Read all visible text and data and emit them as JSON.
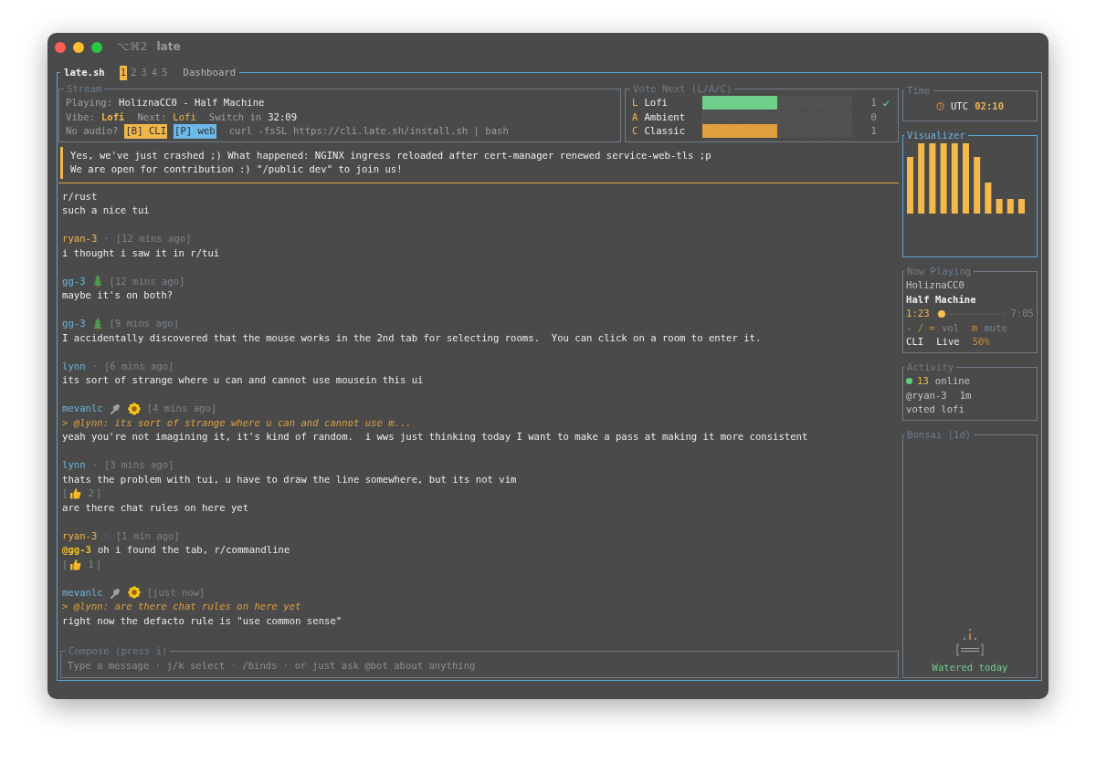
{
  "window": {
    "shortcut": "⌥⌘2",
    "title": "late"
  },
  "app": {
    "name": "late.sh",
    "tabs": [
      {
        "label": "1",
        "selected": true
      },
      {
        "label": "2",
        "selected": false
      },
      {
        "label": "3",
        "selected": false
      },
      {
        "label": "4",
        "selected": false
      },
      {
        "label": "5",
        "selected": false
      }
    ],
    "section": "Dashboard"
  },
  "stream": {
    "title": "Stream",
    "playing_label": "Playing:",
    "playing": "HoliznaCC0 - Half Machine",
    "vibe_label": "Vibe:",
    "vibe": "Lofi",
    "next_label": "Next:",
    "next": "Lofi",
    "switch_label": "Switch in",
    "switch_time": "32:09",
    "no_audio": "No audio?",
    "buttons": [
      {
        "label": "[B] CLI",
        "color": "#f0b64a"
      },
      {
        "label": "[P] web",
        "color": "#6cb8e6"
      }
    ],
    "install": "curl -fsSL https://cli.late.sh/install.sh | bash"
  },
  "vote": {
    "title": "Vote Next (L/A/C)",
    "options": [
      {
        "key": "L",
        "label": "Lofi",
        "level": 0.5,
        "count": "1",
        "voted": true,
        "color": "#6fd08c"
      },
      {
        "key": "A",
        "label": "Ambient",
        "level": 0,
        "count": "0",
        "voted": false
      },
      {
        "key": "C",
        "label": "Classic",
        "level": 0.5,
        "count": "1",
        "voted": false,
        "color": "#e0a040"
      }
    ]
  },
  "banner": {
    "lines": [
      "Yes, we've just crashed ;) What happened: NGINX ingress reloaded after cert-manager renewed service-web-tls ;p",
      "We are open for contribution :) \"/public dev\" to join us!"
    ]
  },
  "messages": [
    {
      "body": [
        {
          "kind": "text",
          "text": "r/rust"
        },
        {
          "kind": "text",
          "text": "such a nice tui"
        }
      ]
    },
    {
      "author": "ryan-3",
      "color": "#f0b64a",
      "separator": "·",
      "time": "[12 mins ago]",
      "body": [
        {
          "kind": "text",
          "text": "i thought i saw it in r/tui"
        }
      ]
    },
    {
      "author": "gg-3",
      "color": "#6cb4e0",
      "badges": [
        {
          "kind": "tree"
        }
      ],
      "time": "[12 mins ago]",
      "body": [
        {
          "kind": "text",
          "text": "maybe it's on both?"
        }
      ]
    },
    {
      "author": "gg-3",
      "color": "#6cb4e0",
      "badges": [
        {
          "kind": "tree"
        }
      ],
      "time": "[9 mins ago]",
      "body": [
        {
          "kind": "text",
          "text": "I accidentally discovered that the mouse works in the 2nd tab for selecting rooms.  You can click on a room to enter it."
        }
      ]
    },
    {
      "author": "lynn",
      "color": "#6cb4e0",
      "separator": "·",
      "time": "[6 mins ago]",
      "body": [
        {
          "kind": "text",
          "text": "its sort of strange where u can and cannot use mousein this ui"
        }
      ]
    },
    {
      "author": "mevanlc",
      "color": "#6cb4e0",
      "badges": [
        {
          "kind": "wrench"
        },
        {
          "kind": "flower"
        }
      ],
      "time": "[4 mins ago]",
      "quote": "> @lynn: its sort of strange where u can and cannot use m...",
      "body": [
        {
          "kind": "text",
          "text": "yeah you're not imagining it, it's kind of random.  i wws just thinking today I want to make a pass at making it more consistent"
        }
      ]
    },
    {
      "author": "lynn",
      "color": "#6cb4e0",
      "separator": "·",
      "time": "[3 mins ago]",
      "body": [
        {
          "kind": "text",
          "text": "thats the problem with tui, u have to draw the line somewhere, but its not vim"
        },
        {
          "kind": "reaction",
          "open": "[",
          "count": "2",
          "close": "]"
        },
        {
          "kind": "text",
          "text": "are there chat rules on here yet"
        }
      ]
    },
    {
      "author": "ryan-3",
      "color": "#f0b64a",
      "separator": "·",
      "time": "[1 min ago]",
      "body": [
        {
          "kind": "text",
          "mention": "@gg-3",
          "text": "oh i found the tab, r/commandline"
        },
        {
          "kind": "reaction",
          "open": "[",
          "count": "1",
          "close": "]"
        }
      ]
    },
    {
      "author": "mevanlc",
      "color": "#6cb4e0",
      "badges": [
        {
          "kind": "wrench"
        },
        {
          "kind": "flower"
        }
      ],
      "time": "[just now]",
      "quote": "> @lynn: are there chat rules on here yet",
      "body": [
        {
          "kind": "text",
          "text": "right now the defacto rule is \"use common sense\""
        }
      ]
    }
  ],
  "compose": {
    "title": "Compose (press i)",
    "placeholder": "Type a message · j/k select · /binds · or just ask @bot about anything"
  },
  "time": {
    "title": "Time",
    "zone": "UTC",
    "time": "02:10"
  },
  "visualizer": {
    "title": "Visualizer"
  },
  "now_playing": {
    "title": "Now Playing",
    "artist": "HoliznaCC0",
    "track": "Half Machine",
    "elapsed": "1:23",
    "total": "7:05",
    "level": 0.05,
    "vol_keys": "- / =",
    "vol_label": "vol",
    "mute_key": "m",
    "mute_label": "mute",
    "mode": "CLI",
    "status": "Live",
    "volume": "50%"
  },
  "activity": {
    "title": "Activity",
    "online_count": "13",
    "online_label": "online",
    "user": "@ryan-3",
    "ago": "1m",
    "action": "voted lofi"
  },
  "bonsai": {
    "title": "Bonsai (1d)",
    "status": "Watered today"
  }
}
